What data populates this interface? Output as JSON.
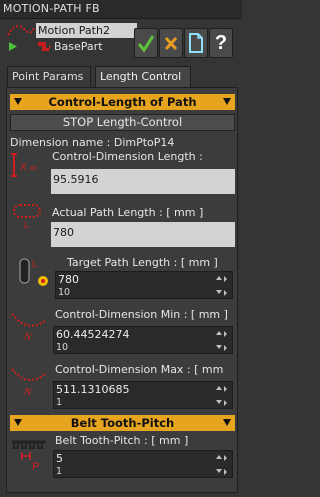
{
  "window": {
    "title": "MOTION-PATH FB"
  },
  "tree": {
    "items": [
      {
        "label": "Motion Path2",
        "icon": "motion-path-icon"
      },
      {
        "label": "BasePart",
        "icon": "part-icon"
      }
    ]
  },
  "toolbar": {
    "ok_icon": "check-icon",
    "cancel_icon": "close-icon",
    "new_icon": "document-icon",
    "help_icon": "help-icon",
    "colors": {
      "ok": "#5dc23a",
      "cancel": "#e79b22",
      "new": "#8fe0ff",
      "help": "#ffffff"
    }
  },
  "tabs": [
    {
      "label": "Point Params",
      "active": false
    },
    {
      "label": "Length Control",
      "active": true
    }
  ],
  "control_length": {
    "section_title": "Control-Length of Path",
    "stop_button": "STOP Length-Control",
    "dimension_name_label": "Dimension name : DimPtoP14",
    "control_dimension_length_label": "Control-Dimension Length :",
    "control_dimension_length_value": "95.5916",
    "actual_path_length_label": "Actual Path Length : [ mm ]",
    "actual_path_length_value": "780",
    "target_path_length_label": "Target Path Length : [ mm ]",
    "target_path_length_value": "780",
    "target_path_length_step": "10",
    "control_dimension_min_label": "Control-Dimension Min : [ mm ]",
    "control_dimension_min_value": "60.44524274",
    "control_dimension_min_step": "10",
    "control_dimension_max_label": "Control-Dimension Max : [ mm",
    "control_dimension_max_value": "511.1310685",
    "control_dimension_max_step": "1"
  },
  "belt": {
    "section_title": "Belt Tooth-Pitch",
    "pitch_label": "Belt Tooth-Pitch : [ mm ]",
    "pitch_value": "5",
    "pitch_step": "1"
  },
  "accent": {
    "section": "#e7a41f",
    "marker": "#d01e1e"
  }
}
